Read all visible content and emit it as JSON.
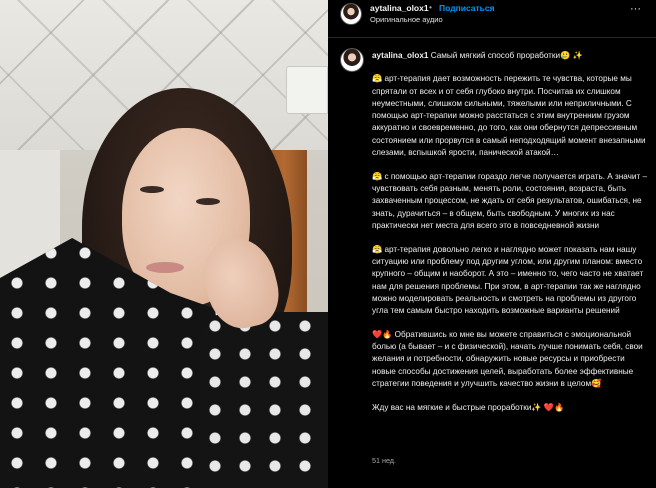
{
  "post": {
    "username": "aytalina_olox1",
    "separator": "•",
    "follow_label": "Подписаться",
    "audio_label": "Оригинальное аудио",
    "more_label": "···",
    "caption_intro": "Самый мягкий способ проработки🥲 ✨",
    "caption_paragraphs": [
      "😤 арт-терапия дает возможность пережить те чувства, которые мы спрятали от всех и от себя глубоко внутри. Посчитав их слишком неуместными, слишком сильными, тяжелыми или неприличными. С помощью арт-терапии можно расстаться с этим внутренним грузом аккуратно и своевременно, до того, как они обернутся депрессивным состоянием или прорвутся в самый неподходящий момент внезапными слезами, вспышкой ярости, панической атакой…",
      "😤 с помощью арт-терапии гораздо легче получается играть. А значит – чувствовать себя разным, менять роли, состояния, возраста, быть захваченным процессом, не ждать от себя результатов, ошибаться, не знать, дурачиться – в общем, быть свободным. У многих из нас практически нет места для всего это в повседневной жизни",
      "😤 арт-терапия довольно легко и наглядно может показать нам нашу ситуацию или проблему под другим углом, или другим планом: вместо крупного – общим и наоборот. А это – именно то, чего часто не хватает нам для решения проблемы. При этом, в арт-терапии так же наглядно можно моделировать реальность и смотреть на проблемы из другого угла тем самым быстро находить возможные варианты решений",
      "❤️🔥 Обратившись ко мне вы можете справиться с эмоциональной болью (а бывает – и с физической), начать лучше понимать себя, свои желания и потребности, обнаружить новые ресурсы и приобрести новые способы достижения целей, выработать более эффективные стратегии поведения и улучшить качество жизни в целом🥰",
      "Жду вас на мягкие и быстрые проработки✨ ❤️🔥"
    ],
    "timestamp": "51 нед."
  },
  "colors": {
    "background": "#000000",
    "text": "#f5f5f5",
    "secondary_text": "#a8a8a8",
    "follow_blue": "#0095f6"
  },
  "icons": {
    "more": "more-horizontal-icon"
  }
}
